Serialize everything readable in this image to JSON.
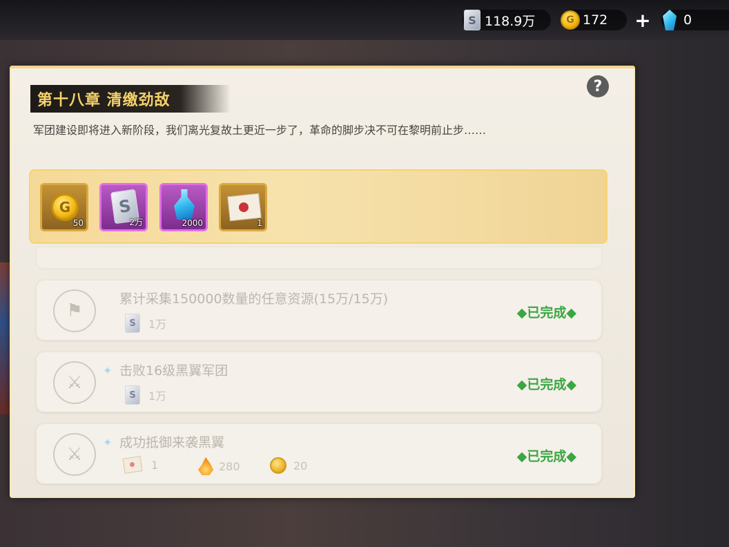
{
  "topbar": {
    "silver": {
      "icon": "silver-card-icon",
      "value": "118.9万"
    },
    "gold": {
      "icon": "gold-coin-icon",
      "value": "172"
    },
    "add": "+",
    "gem": {
      "icon": "blue-gem-icon",
      "value": "0"
    }
  },
  "panel": {
    "title": "第十八章 清缴劲敌",
    "help": "?",
    "description": "军团建设即将进入新阶段，我们离光复故土更近一步了，革命的脚步决不可在黎明前止步……",
    "rewards": [
      {
        "icon": "gold-coin-icon",
        "qty": "50",
        "frame": "gold"
      },
      {
        "icon": "silver-card-icon",
        "qty": "2万",
        "frame": "purple"
      },
      {
        "icon": "blue-potion-icon",
        "qty": "2000",
        "frame": "purple"
      },
      {
        "icon": "sealed-letter-icon",
        "qty": "1",
        "frame": "gold"
      }
    ]
  },
  "tasks": [
    {
      "icon": "flag-icon",
      "name": "累计采集150000数量的任意资源(15万/15万)",
      "rewards": [
        {
          "icon": "silver-card-icon",
          "qty": "1万"
        }
      ],
      "status": "◆已完成◆"
    },
    {
      "icon": "crossed-swords-icon",
      "name": "击败16级黑翼军团",
      "rewards": [
        {
          "icon": "silver-card-icon",
          "qty": "1万"
        }
      ],
      "status": "◆已完成◆"
    },
    {
      "icon": "crossed-swords-icon",
      "name": "成功抵御来袭黑翼",
      "rewards": [
        {
          "icon": "sealed-letter-icon",
          "qty": "1"
        },
        {
          "icon": "fire-icon",
          "qty": "280"
        },
        {
          "icon": "gold-coin-icon",
          "qty": "20"
        }
      ],
      "status": "◆已完成◆"
    }
  ],
  "colors": {
    "title_text": "#f6d36b",
    "done_text": "#3aa742",
    "reward_strip": "#f5d998"
  }
}
